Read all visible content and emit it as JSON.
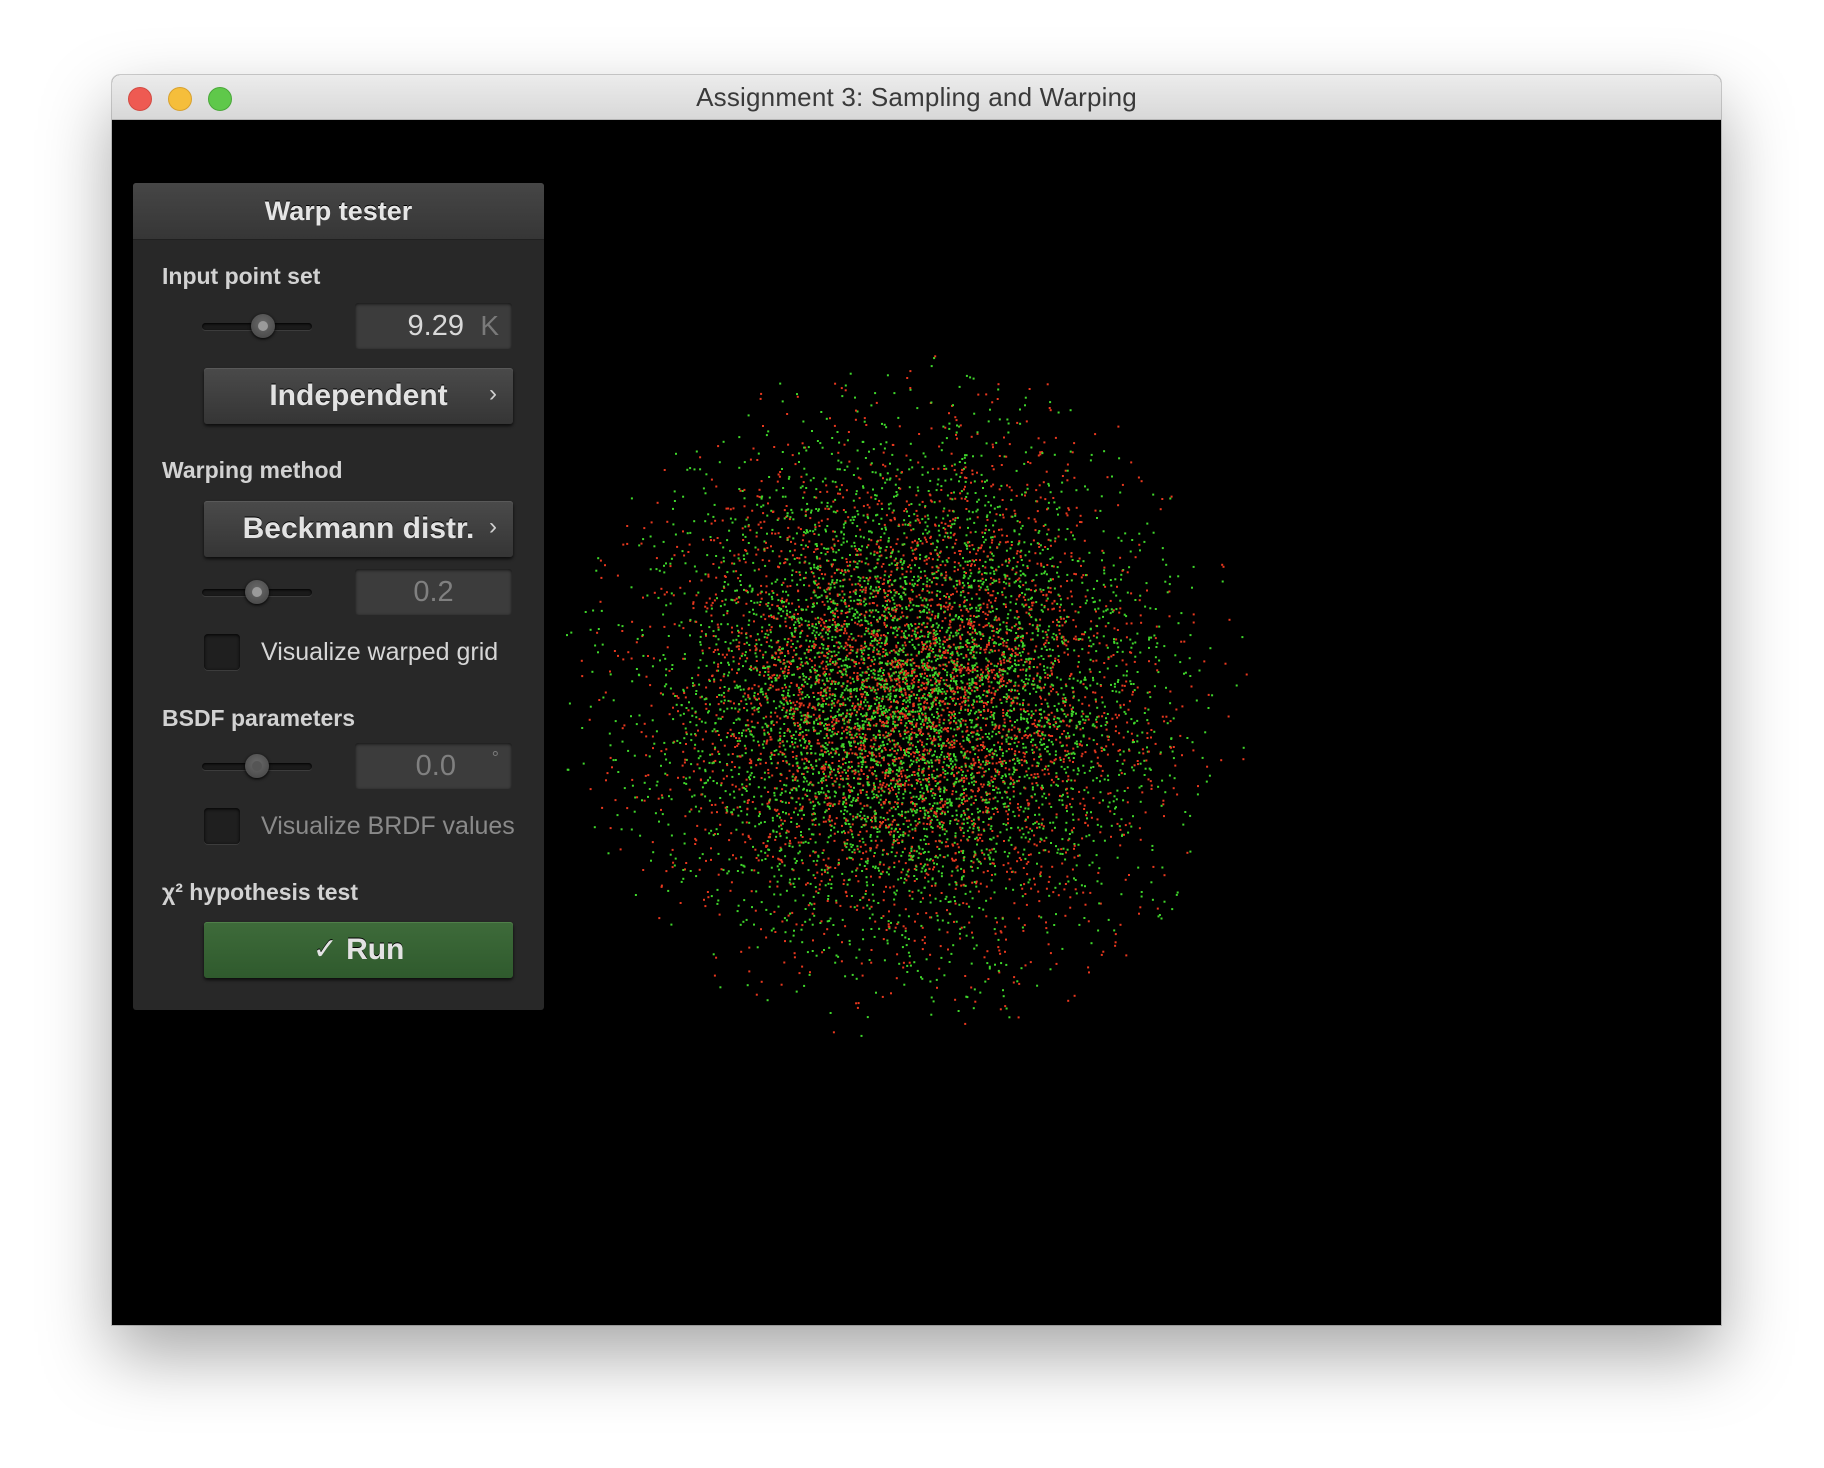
{
  "window": {
    "title": "Assignment 3: Sampling and Warping"
  },
  "panel": {
    "title": "Warp tester",
    "input_point_set": {
      "label": "Input point set",
      "slider_level": 0.55,
      "count_value": "9.29",
      "count_unit": "K",
      "point_type_label": "Independent",
      "chevron_icon": "chevron-right-icon"
    },
    "warping_method": {
      "label": "Warping method",
      "method_label": "Beckmann distr.",
      "chevron_icon": "chevron-right-icon",
      "slider_level": 0.5,
      "parameter_value": "0.2",
      "visualize_grid_label": "Visualize warped grid",
      "visualize_grid_checked": false
    },
    "bsdf_parameters": {
      "label": "BSDF parameters",
      "slider_level": 0.5,
      "angle_value": "0.0",
      "angle_unit": "°",
      "visualize_brdf_label": "Visualize BRDF values",
      "visualize_brdf_checked": false
    },
    "hypothesis_test": {
      "label": "χ² hypothesis test",
      "run_label": "✓ Run"
    }
  },
  "colors": {
    "point_a": "#3fd62b",
    "point_b": "#e8381e",
    "run_button": "#336030",
    "background": "#000000"
  },
  "chart_data": {
    "type": "scatter",
    "title": "",
    "description_of_distribution": "Beckmann distribution warped points, roughness 0.2",
    "point_count": 9290,
    "series": [
      {
        "color": "#3fd62b"
      },
      {
        "color": "#e8381e"
      }
    ]
  }
}
